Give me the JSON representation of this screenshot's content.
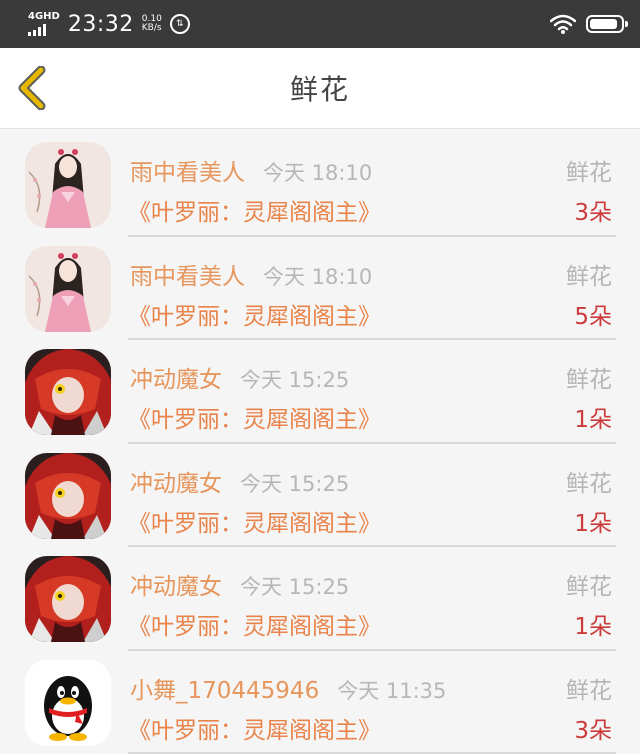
{
  "status_bar": {
    "network": "4GHD",
    "time": "23:32",
    "speed_value": "0.10",
    "speed_unit": "KB/s",
    "indicator_icon": "upload-download-icon",
    "wifi_icon": "wifi-icon",
    "battery_icon": "battery-icon",
    "battery_level": 0.9
  },
  "nav": {
    "back_icon": "back-chevron-icon",
    "title": "鲜花",
    "accent_color": "#e8b800"
  },
  "items": [
    {
      "sender": "雨中看美人",
      "time": "今天 18:10",
      "gift_type": "鲜花",
      "book": "《叶罗丽：灵犀阁阁主》",
      "count": "3朵",
      "avatar": "anime-girl-pink-avatar"
    },
    {
      "sender": "雨中看美人",
      "time": "今天 18:10",
      "gift_type": "鲜花",
      "book": "《叶罗丽：灵犀阁阁主》",
      "count": "5朵",
      "avatar": "anime-girl-pink-avatar"
    },
    {
      "sender": "冲动魔女",
      "time": "今天 15:25",
      "gift_type": "鲜花",
      "book": "《叶罗丽：灵犀阁阁主》",
      "count": "1朵",
      "avatar": "red-hair-anime-avatar"
    },
    {
      "sender": "冲动魔女",
      "time": "今天 15:25",
      "gift_type": "鲜花",
      "book": "《叶罗丽：灵犀阁阁主》",
      "count": "1朵",
      "avatar": "red-hair-anime-avatar"
    },
    {
      "sender": "冲动魔女",
      "time": "今天 15:25",
      "gift_type": "鲜花",
      "book": "《叶罗丽：灵犀阁阁主》",
      "count": "1朵",
      "avatar": "red-hair-anime-avatar"
    },
    {
      "sender": "小舞_170445946",
      "time": "今天 11:35",
      "gift_type": "鲜花",
      "book": "《叶罗丽：灵犀阁阁主》",
      "count": "3朵",
      "avatar": "qq-penguin-avatar"
    }
  ],
  "colors": {
    "sender": "#e6965c",
    "book": "#e8834a",
    "count": "#cc3b3b",
    "muted": "#b5b5b5",
    "status_bar_bg": "#3a3a3a"
  }
}
